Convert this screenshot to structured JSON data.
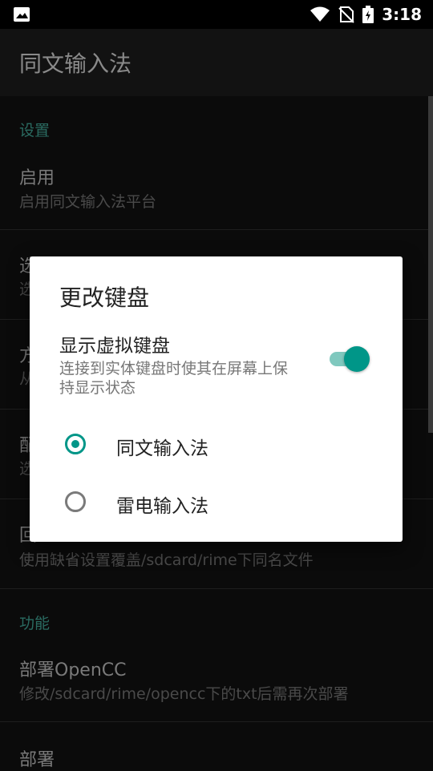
{
  "status_bar": {
    "time": "3:18",
    "icons": [
      "image-icon",
      "wifi-icon",
      "no-sim-icon",
      "battery-charging-icon"
    ]
  },
  "app_bar": {
    "title": "同文输入法"
  },
  "sections": [
    {
      "header": "设置"
    },
    {
      "header": "功能"
    }
  ],
  "prefs": [
    {
      "title": "启用",
      "subtitle": "启用同文输入法平台"
    },
    {
      "title": "选",
      "subtitle": "选"
    },
    {
      "title": "方",
      "subtitle": "从"
    },
    {
      "title": "配",
      "subtitle": "选"
    },
    {
      "title": "回",
      "subtitle": "使用缺省设置覆盖/sdcard/rime下同名文件"
    },
    {
      "title": "部署OpenCC",
      "subtitle": "修改/sdcard/rime/opencc下的txt后需再次部署"
    },
    {
      "title": "部署",
      "subtitle": ""
    }
  ],
  "dialog": {
    "title": "更改键盘",
    "switch_title": "显示虚拟键盘",
    "switch_subtitle": "连接到实体键盘时使其在屏幕上保持显示状态",
    "switch_on": true,
    "accent_color": "#009688",
    "options": [
      {
        "label": "同文输入法",
        "selected": true
      },
      {
        "label": "雷电输入法",
        "selected": false
      }
    ]
  }
}
